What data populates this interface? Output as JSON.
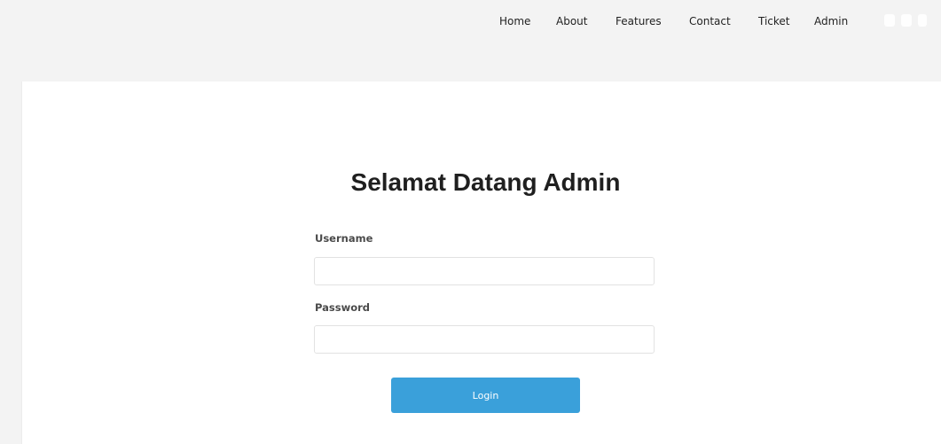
{
  "nav": {
    "items": [
      {
        "label": "Home"
      },
      {
        "label": "About"
      },
      {
        "label": "Features"
      },
      {
        "label": "Contact"
      },
      {
        "label": "Ticket"
      },
      {
        "label": "Admin"
      }
    ]
  },
  "social": {
    "icons": [
      "instagram-icon",
      "tiktok-icon",
      "linkedin-icon"
    ]
  },
  "login": {
    "title": "Selamat Datang Admin",
    "username_label": "Username",
    "username_value": "",
    "password_label": "Password",
    "password_value": "",
    "button_label": "Login"
  },
  "colors": {
    "topbar_bg": "#f3f3f3",
    "button_bg": "#3aa0da",
    "title_text": "#1f1f1f"
  }
}
